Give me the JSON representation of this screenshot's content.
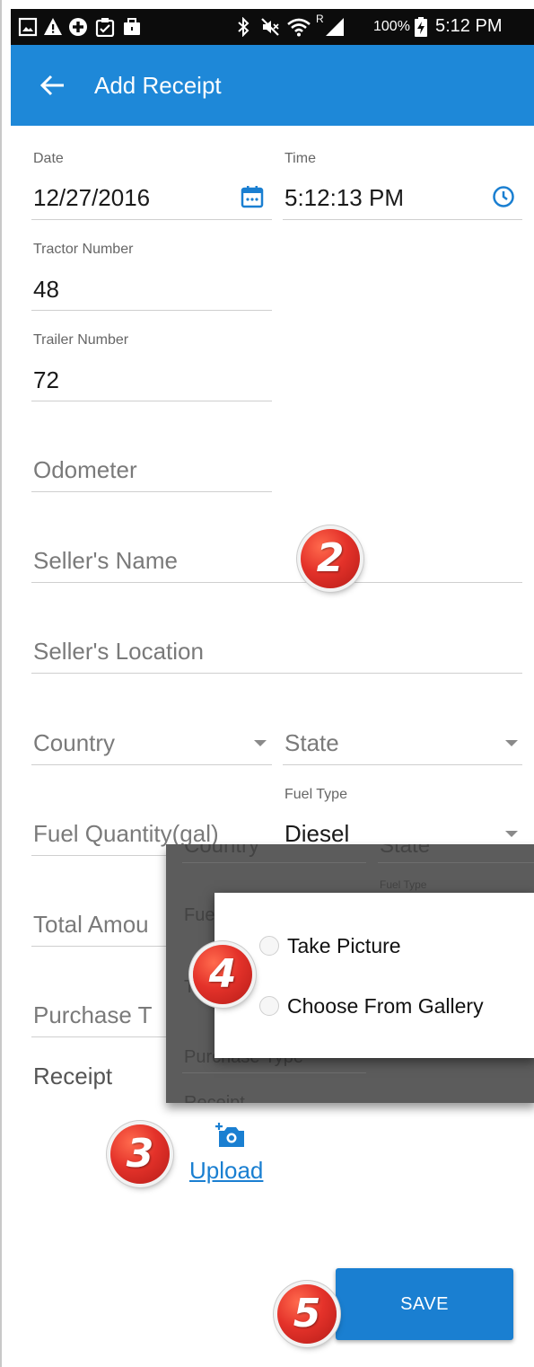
{
  "status_bar": {
    "battery_text": "100%",
    "time": "5:12 PM",
    "roaming_indicator": "R",
    "left_icons": [
      "image-icon",
      "warning-icon",
      "plus-circle-icon",
      "clipboard-icon",
      "briefcase-icon"
    ],
    "right_icons": [
      "bluetooth-icon",
      "mute-icon",
      "wifi-icon",
      "signal-icon",
      "battery-charging-icon"
    ]
  },
  "app_bar": {
    "title": "Add Receipt",
    "color": "#1e88d8"
  },
  "form": {
    "date": {
      "label": "Date",
      "value": "12/27/2016"
    },
    "time": {
      "label": "Time",
      "value": "5:12:13 PM"
    },
    "tractor_number": {
      "label": "Tractor Number",
      "value": "48"
    },
    "trailer_number": {
      "label": "Trailer Number",
      "value": "72"
    },
    "odometer": {
      "placeholder": "Odometer"
    },
    "sellers_name": {
      "placeholder": "Seller's Name"
    },
    "sellers_location": {
      "placeholder": "Seller's Location"
    },
    "country": {
      "placeholder": "Country"
    },
    "state": {
      "placeholder": "State"
    },
    "fuel_quantity": {
      "placeholder": "Fuel Quantity(gal)"
    },
    "fuel_type": {
      "label": "Fuel Type",
      "value": "Diesel"
    },
    "total_amount": {
      "placeholder": "Total Amou"
    },
    "purchase_type": {
      "placeholder": "Purchase T"
    },
    "receipt": {
      "label": "Receipt"
    }
  },
  "overlay_background": {
    "country": "Country",
    "state": "State",
    "fuel_type": "Fuel Type",
    "fuel_prefix": "Fue",
    "total_prefix": "T",
    "purchase_type": "Purchase Type",
    "receipt": "Receipt"
  },
  "dialog": {
    "options": [
      {
        "label": "Take Picture",
        "selected": false
      },
      {
        "label": "Choose From Gallery",
        "selected": false
      }
    ]
  },
  "upload": {
    "label": "Upload",
    "icon": "add-camera-icon"
  },
  "save_button": {
    "label": "SAVE",
    "color": "#1a7fd1"
  },
  "annotations": {
    "badge_2": "2",
    "badge_3": "3",
    "badge_4": "4",
    "badge_5": "5",
    "color": "#e4322a"
  }
}
